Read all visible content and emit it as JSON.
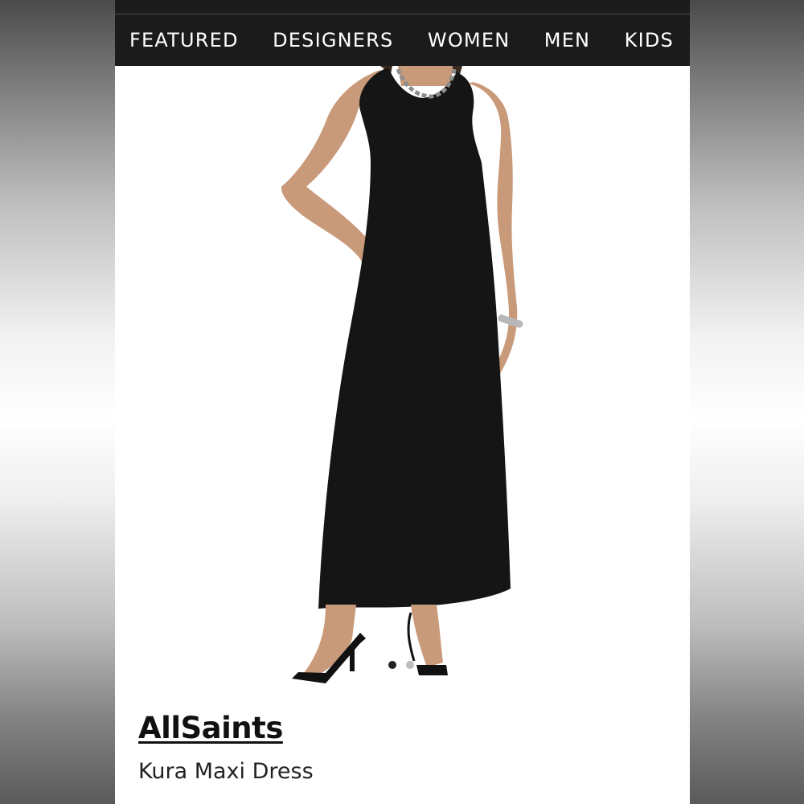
{
  "nav": {
    "items": [
      {
        "label": "FEATURED"
      },
      {
        "label": "DESIGNERS"
      },
      {
        "label": "WOMEN"
      },
      {
        "label": "MEN"
      },
      {
        "label": "KIDS"
      }
    ]
  },
  "gallery": {
    "image_subject": "dress-photo",
    "dot_count": 2,
    "active_dot_index": 0,
    "active_dot_color": "#222222",
    "inactive_dot_color": "#bdbdbd"
  },
  "product": {
    "brand": "AllSaints",
    "name": "Kura Maxi Dress"
  },
  "colors": {
    "nav_bg": "#1b1b1b",
    "nav_text": "#ffffff",
    "dress": "#151515",
    "skin": "#c99a7a"
  }
}
